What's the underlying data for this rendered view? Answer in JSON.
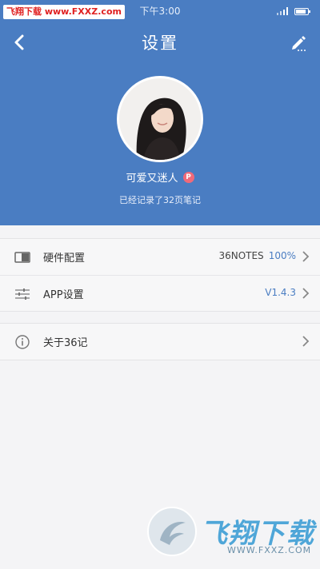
{
  "status_bar": {
    "watermark": "飞翔下载 www.FXXZ.com",
    "time": "下午3:00"
  },
  "header": {
    "title": "设置",
    "back_icon": "chevron-left-icon",
    "edit_icon": "pen-icon",
    "background_color": "#4a7dc2"
  },
  "profile": {
    "username": "可爱又迷人",
    "badge": "P",
    "notes_summary": "已经记录了32页笔记"
  },
  "menu": {
    "hardware": {
      "label": "硬件配置",
      "value": "36NOTES",
      "percent": "100%",
      "icon": "device-icon"
    },
    "app": {
      "label": "APP设置",
      "value": "V1.4.3",
      "icon": "sliders-icon"
    },
    "about": {
      "label": "关于36记",
      "icon": "info-icon"
    }
  },
  "watermark_bottom": {
    "brand": "飞翔下载",
    "url": "WWW.FXXZ.COM"
  },
  "colors": {
    "accent": "#4a7dc2",
    "badge": "#f06a7a"
  }
}
